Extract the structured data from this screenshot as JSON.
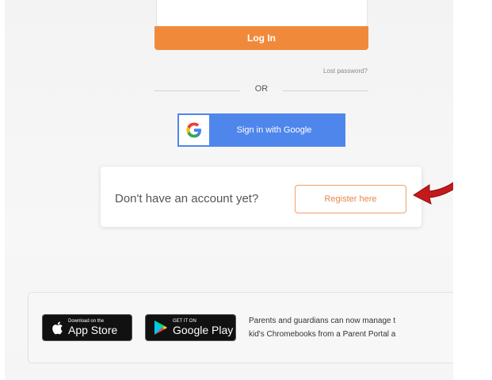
{
  "login": {
    "button_label": "Log In",
    "lost_password": "Lost password?",
    "or_label": "OR"
  },
  "google": {
    "label": "Sign in with Google",
    "g_letter": "G"
  },
  "register": {
    "prompt": "Don't have an account yet?",
    "button_label": "Register here"
  },
  "apps": {
    "app_store": {
      "small": "Download on the",
      "big": "App Store"
    },
    "google_play": {
      "small": "GET IT ON",
      "big": "Google Play"
    },
    "description_line1": "Parents and guardians can now manage t",
    "description_line2": "kid's Chromebooks from a Parent Portal a"
  },
  "colors": {
    "login_orange": "#f08a3a",
    "google_blue": "#4f86ec",
    "register_orange": "#e8864a",
    "arrow_red": "#c41a1a"
  }
}
